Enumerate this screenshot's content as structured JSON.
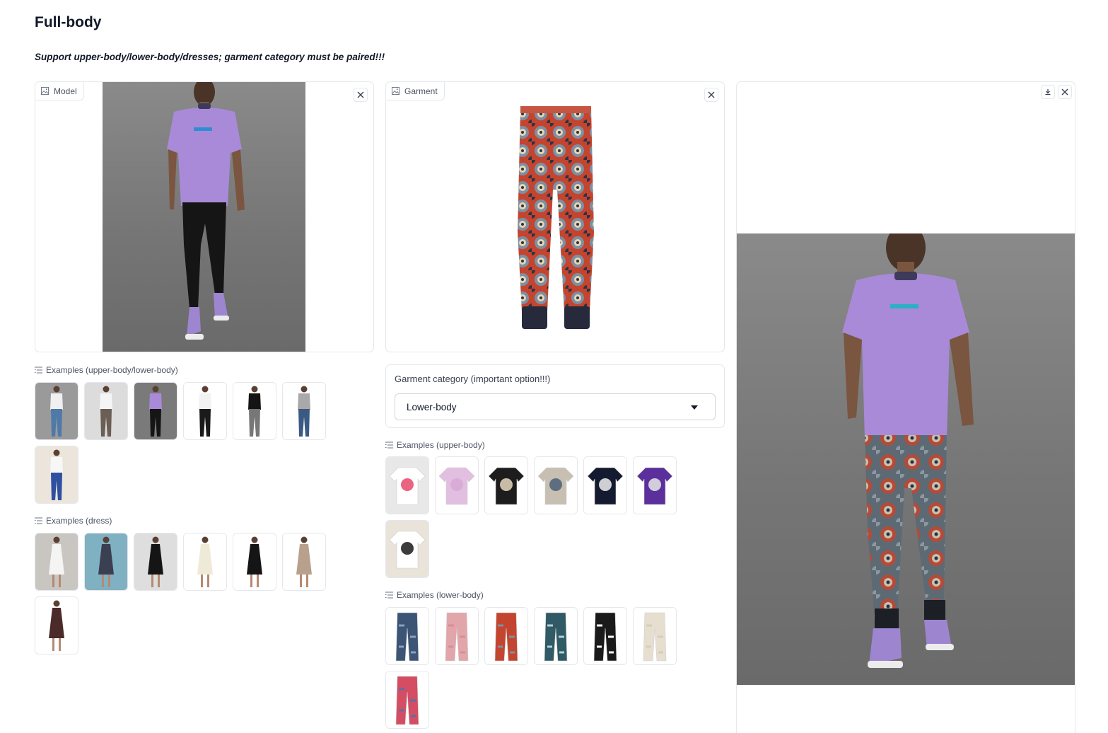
{
  "page": {
    "title": "Full-body",
    "subtitle": "Support upper-body/lower-body/dresses; garment category must be paired!!!"
  },
  "model_panel": {
    "label": "Model"
  },
  "garment_panel": {
    "label": "Garment"
  },
  "garment_category": {
    "label": "Garment category (important option!!!)",
    "selected": "Lower-body"
  },
  "examples": {
    "model_upper_lower": {
      "label": "Examples (upper-body/lower-body)",
      "items": [
        "model-white-top-jeans",
        "model-tee-patterned-pants",
        "model-purple-tee-black-pants",
        "model-white-cami-black-pants",
        "model-black-tee-grey-jeans",
        "model-grey-sweater-jeans",
        "model-white-tee-blue-pants"
      ]
    },
    "model_dress": {
      "label": "Examples (dress)",
      "items": [
        "dress-white",
        "dress-sequin-blue",
        "dress-black-slip",
        "dress-cream-slip",
        "dress-black-fitted",
        "dress-beige",
        "dress-brown-floral"
      ]
    },
    "garment_upper": {
      "label": "Examples (upper-body)",
      "items": [
        "shirt-floral-print",
        "blouse-pink-ruffle",
        "blouse-black-floral",
        "shirt-printed-scenic",
        "tee-black-graphic",
        "sweatshirt-purple",
        "tee-armani-white"
      ]
    },
    "garment_lower": {
      "label": "Examples (lower-body)",
      "items": [
        "jeans-patchwork",
        "pants-pink",
        "pants-paisley",
        "pants-teal-print",
        "pants-zigzag",
        "pants-cream",
        "pants-multicolor"
      ]
    }
  },
  "colors": {
    "tshirt_purple": "#a98ad8",
    "backdrop_grey": "#7c7c7c",
    "paisley_red": "#c4452f",
    "border": "#e5e7eb"
  }
}
